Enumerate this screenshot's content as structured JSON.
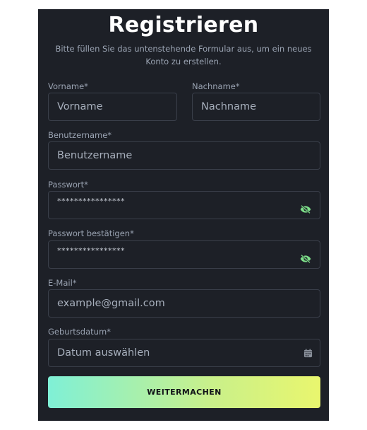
{
  "header": {
    "title": "Registrieren",
    "subtitle": "Bitte füllen Sie das untenstehende Formular aus, um ein neues Konto zu erstellen."
  },
  "form": {
    "first_name": {
      "label": "Vorname*",
      "placeholder": "Vorname",
      "value": ""
    },
    "last_name": {
      "label": "Nachname*",
      "placeholder": "Nachname",
      "value": ""
    },
    "username": {
      "label": "Benutzername*",
      "placeholder": "Benutzername",
      "value": ""
    },
    "password": {
      "label": "Passwort*",
      "masked_value": "****************",
      "toggle_icon": "eye-slash-icon"
    },
    "password_confirm": {
      "label": "Passwort bestätigen*",
      "masked_value": "****************",
      "toggle_icon": "eye-slash-icon"
    },
    "email": {
      "label": "E-Mail*",
      "placeholder": "example@gmail.com",
      "value": ""
    },
    "birthdate": {
      "label": "Geburtsdatum*",
      "placeholder": "Datum auswählen",
      "value": "",
      "icon": "calendar-icon"
    },
    "submit_label": "WEITERMACHEN"
  },
  "colors": {
    "panel_background": "#1d2027",
    "field_border": "#3a3f4a",
    "accent_eye": "#7ee08a",
    "button_gradient_start": "#7ff0d6",
    "button_gradient_end": "#e9f66e"
  }
}
